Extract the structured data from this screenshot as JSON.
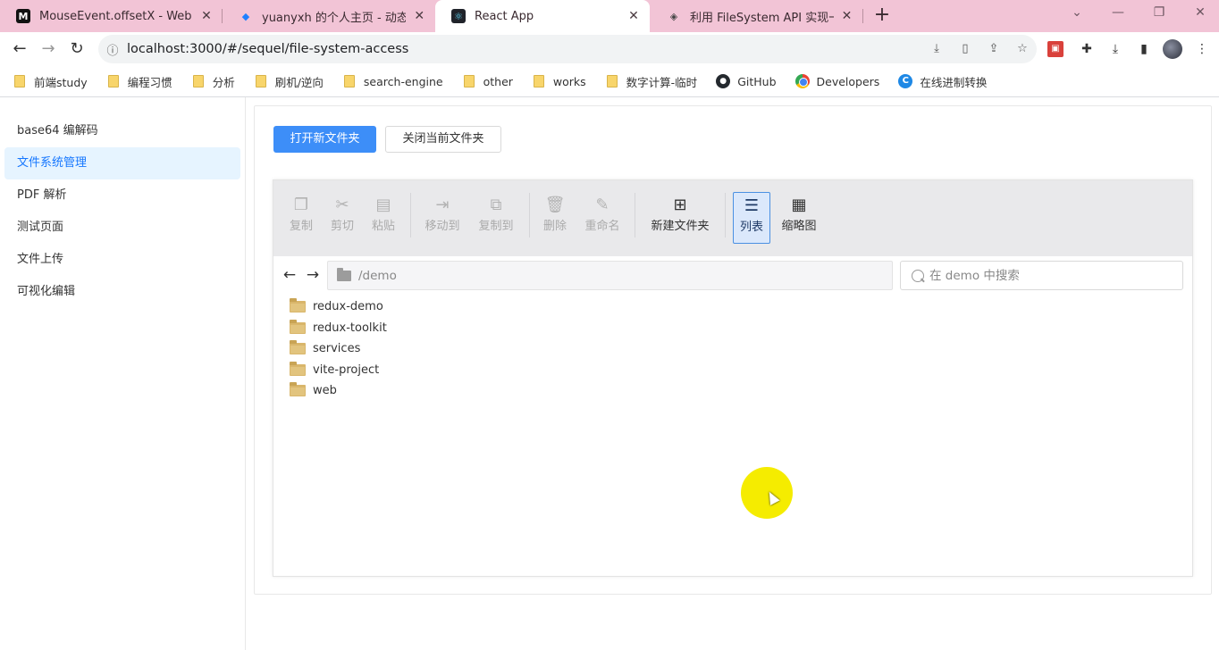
{
  "browser": {
    "tabs": [
      {
        "title": "MouseEvent.offsetX - Web API",
        "favicon": "mdn-icon",
        "active": false
      },
      {
        "title": "yuanyxh 的个人主页 - 动态 - 掘",
        "favicon": "juejin-icon",
        "active": false
      },
      {
        "title": "React App",
        "favicon": "react-icon",
        "active": true
      },
      {
        "title": "利用 FileSystem API 实现一个 w",
        "favicon": "git-icon",
        "active": false
      }
    ],
    "close_glyph": "✕",
    "new_tab_glyph": "+",
    "url": "localhost:3000/#/sequel/file-system-access",
    "bookmarks": [
      {
        "label": "前端study",
        "type": "folder"
      },
      {
        "label": "编程习惯",
        "type": "folder"
      },
      {
        "label": "分析",
        "type": "folder"
      },
      {
        "label": "刷机/逆向",
        "type": "folder"
      },
      {
        "label": "search-engine",
        "type": "folder"
      },
      {
        "label": "other",
        "type": "folder"
      },
      {
        "label": "works",
        "type": "folder"
      },
      {
        "label": "数字计算-临时",
        "type": "folder"
      },
      {
        "label": "GitHub",
        "type": "github"
      },
      {
        "label": "Developers",
        "type": "chrome"
      },
      {
        "label": "在线进制转换",
        "type": "c"
      }
    ]
  },
  "sidebar": {
    "items": [
      {
        "label": "base64 编解码",
        "active": false
      },
      {
        "label": "文件系统管理",
        "active": true
      },
      {
        "label": "PDF 解析",
        "active": false
      },
      {
        "label": "测试页面",
        "active": false
      },
      {
        "label": "文件上传",
        "active": false
      },
      {
        "label": "可视化编辑",
        "active": false
      }
    ]
  },
  "main": {
    "open_folder_label": "打开新文件夹",
    "close_folder_label": "关闭当前文件夹"
  },
  "file_manager": {
    "tools": [
      {
        "label": "复制",
        "icon": "copy-icon",
        "enabled": false
      },
      {
        "label": "剪切",
        "icon": "scissors-icon",
        "enabled": false
      },
      {
        "label": "粘贴",
        "icon": "paste-icon",
        "enabled": false
      },
      {
        "label": "移动到",
        "icon": "move-to-icon",
        "enabled": false
      },
      {
        "label": "复制到",
        "icon": "copy-to-icon",
        "enabled": false
      },
      {
        "label": "删除",
        "icon": "trash-icon",
        "enabled": false
      },
      {
        "label": "重命名",
        "icon": "rename-icon",
        "enabled": false
      },
      {
        "label": "新建文件夹",
        "icon": "new-folder-icon",
        "enabled": true
      },
      {
        "label": "列表",
        "icon": "list-view-icon",
        "enabled": true,
        "selected": true
      },
      {
        "label": "缩略图",
        "icon": "grid-view-icon",
        "enabled": true
      }
    ],
    "path": "/demo",
    "search_placeholder": "在 demo 中搜索",
    "files": [
      "redux-demo",
      "redux-toolkit",
      "services",
      "vite-project",
      "web"
    ]
  },
  "colors": {
    "tab_strip": "#f2c4d6",
    "primary": "#3d8ef8",
    "menu_active_bg": "#e6f4ff",
    "menu_active_text": "#1677ff",
    "cursor_highlight": "#f5ec00"
  }
}
